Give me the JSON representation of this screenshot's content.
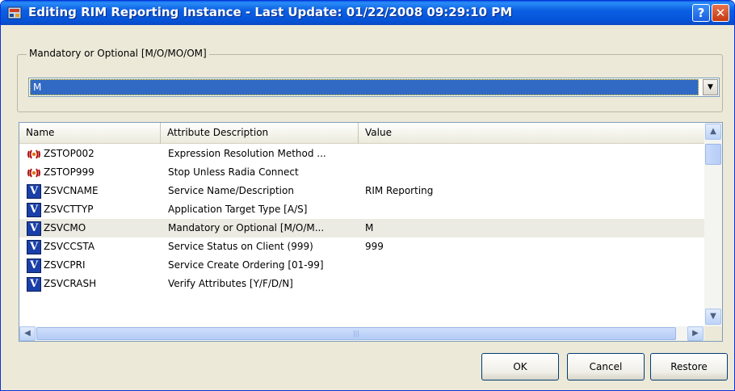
{
  "window": {
    "title": "Editing RIM Reporting Instance - Last Update: 01/22/2008 09:29:10 PM",
    "help_glyph": "?",
    "close_glyph": "✕"
  },
  "group": {
    "label": "Mandatory or Optional [M/O/MO/OM]",
    "selected_value": "M",
    "dropdown_glyph": "▼"
  },
  "list": {
    "columns": [
      "Name",
      "Attribute Description",
      "Value"
    ],
    "rows": [
      {
        "icon": "method-icon",
        "name": "ZSTOP002",
        "description": "Expression Resolution Method ...",
        "value": ""
      },
      {
        "icon": "method-icon",
        "name": "ZSTOP999",
        "description": "Stop Unless Radia Connect",
        "value": ""
      },
      {
        "icon": "variable-icon",
        "name": "ZSVCNAME",
        "description": "Service Name/Description",
        "value": "RIM Reporting"
      },
      {
        "icon": "variable-icon",
        "name": "ZSVCTTYP",
        "description": "Application Target Type [A/S]",
        "value": ""
      },
      {
        "icon": "variable-icon",
        "name": "ZSVCMO",
        "description": "Mandatory or Optional [M/O/M...",
        "value": "M"
      },
      {
        "icon": "variable-icon",
        "name": "ZSVCCSTA",
        "description": "Service Status on Client (999)",
        "value": "999"
      },
      {
        "icon": "variable-icon",
        "name": "ZSVCPRI",
        "description": "Service Create Ordering [01-99]",
        "value": ""
      },
      {
        "icon": "variable-icon",
        "name": "ZSVCRASH",
        "description": "Verify Attributes [Y/F/D/N]",
        "value": ""
      }
    ],
    "variable_icon_glyph": "V",
    "selected_row_name": "ZSVCMO"
  },
  "scroll": {
    "up": "▲",
    "down": "▼",
    "left": "◀",
    "right": "▶",
    "grip": "|||"
  },
  "buttons": {
    "ok": "OK",
    "cancel": "Cancel",
    "restore": "Restore"
  }
}
